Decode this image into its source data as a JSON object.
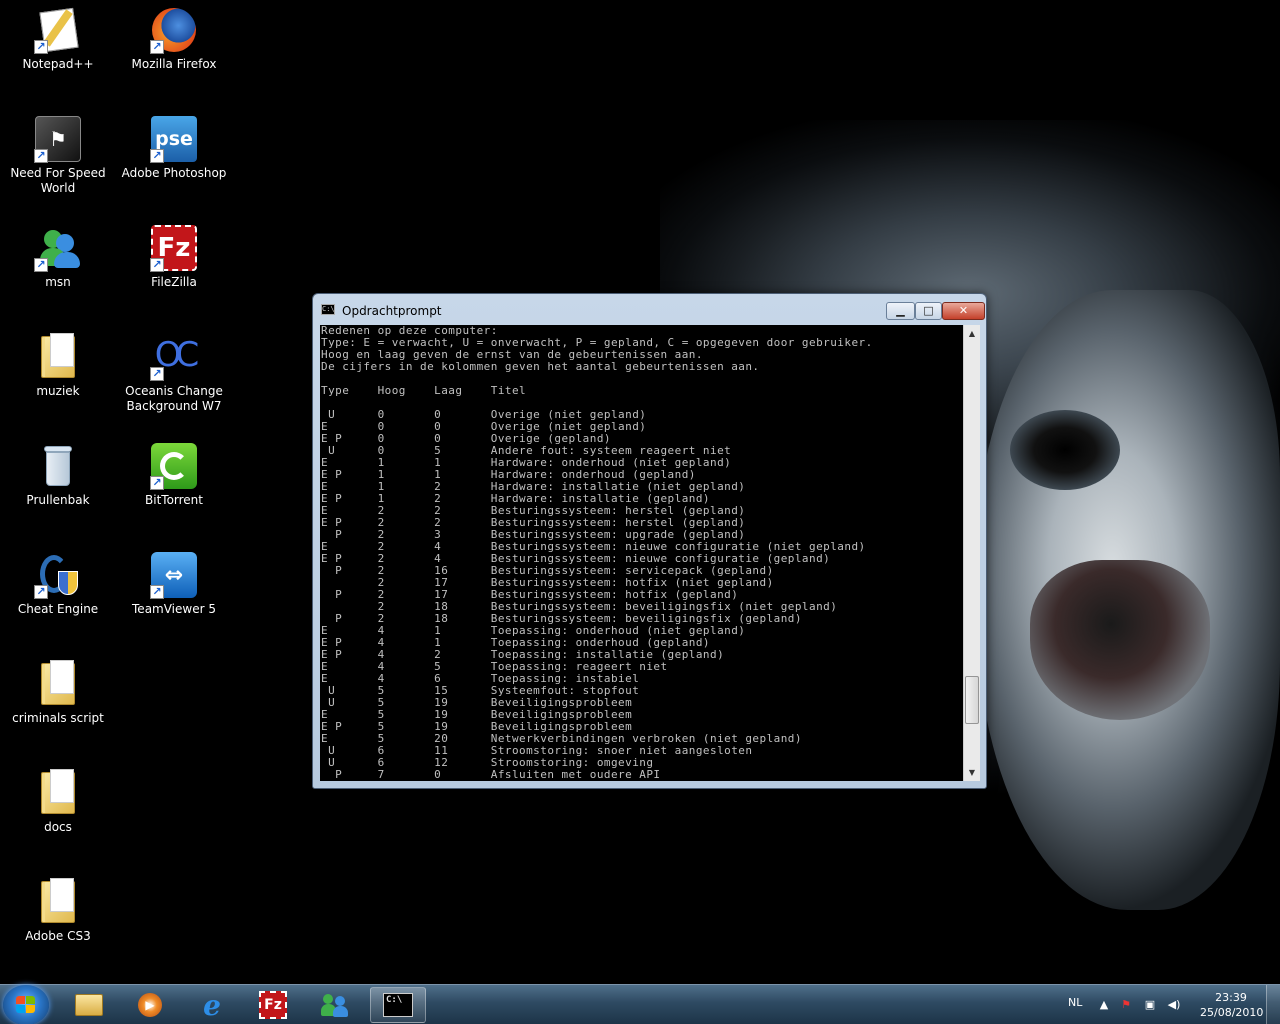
{
  "desktop": {
    "icons": [
      {
        "label": "Notepad++",
        "icon": "notepad-icon"
      },
      {
        "label": "Mozilla Firefox",
        "icon": "firefox-icon"
      },
      {
        "label": "Need For Speed World",
        "icon": "nfs-icon"
      },
      {
        "label": "Adobe Photoshop",
        "icon": "photoshop-icon"
      },
      {
        "label": "msn",
        "icon": "msn-icon"
      },
      {
        "label": "FileZilla",
        "icon": "filezilla-icon"
      },
      {
        "label": "muziek",
        "icon": "folder-icon"
      },
      {
        "label": "Oceanis Change Background W7",
        "icon": "oceanis-icon"
      },
      {
        "label": "Prullenbak",
        "icon": "recycle-bin-icon"
      },
      {
        "label": "BitTorrent",
        "icon": "bittorrent-icon"
      },
      {
        "label": "Cheat Engine",
        "icon": "cheat-engine-icon"
      },
      {
        "label": "TeamViewer 5",
        "icon": "teamviewer-icon"
      },
      {
        "label": "criminals script",
        "icon": "folder-icon"
      },
      {
        "label": "docs",
        "icon": "folder-icon"
      },
      {
        "label": "Adobe CS3",
        "icon": "folder-icon"
      }
    ],
    "glyphs": {
      "pse": "pse",
      "fz": "Fz",
      "oc": "OC",
      "cmd": "C:\\"
    }
  },
  "cmd_window": {
    "title": "Opdrachtprompt",
    "buttons": {
      "minimize": "▁",
      "maximize": "□",
      "close": "✕"
    },
    "scroll": {
      "up": "▲",
      "down": "▼"
    },
    "lines": [
      "Redenen op deze computer:",
      "Type: E = verwacht, U = onverwacht, P = gepland, C = opgegeven door gebruiker.",
      "Hoog en laag geven de ernst van de gebeurtenissen aan.",
      "De cijfers in de kolommen geven het aantal gebeurtenissen aan.",
      "",
      "Type    Hoog    Laag    Titel",
      "",
      " U      0       0       Overige (niet gepland)",
      "E       0       0       Overige (niet gepland)",
      "E P     0       0       Overige (gepland)",
      " U      0       5       Andere fout: systeem reageert niet",
      "E       1       1       Hardware: onderhoud (niet gepland)",
      "E P     1       1       Hardware: onderhoud (gepland)",
      "E       1       2       Hardware: installatie (niet gepland)",
      "E P     1       2       Hardware: installatie (gepland)",
      "E       2       2       Besturingssysteem: herstel (gepland)",
      "E P     2       2       Besturingssysteem: herstel (gepland)",
      "  P     2       3       Besturingssysteem: upgrade (gepland)",
      "E       2       4       Besturingssysteem: nieuwe configuratie (niet gepland)",
      "E P     2       4       Besturingssysteem: nieuwe configuratie (gepland)",
      "  P     2       16      Besturingssysteem: servicepack (gepland)",
      "        2       17      Besturingssysteem: hotfix (niet gepland)",
      "  P     2       17      Besturingssysteem: hotfix (gepland)",
      "        2       18      Besturingssysteem: beveiligingsfix (niet gepland)",
      "  P     2       18      Besturingssysteem: beveiligingsfix (gepland)",
      "E       4       1       Toepassing: onderhoud (niet gepland)",
      "E P     4       1       Toepassing: onderhoud (gepland)",
      "E P     4       2       Toepassing: installatie (gepland)",
      "E       4       5       Toepassing: reageert niet",
      "E       4       6       Toepassing: instabiel",
      " U      5       15      Systeemfout: stopfout",
      " U      5       19      Beveiligingsprobleem",
      "E       5       19      Beveiligingsprobleem",
      "E P     5       19      Beveiligingsprobleem",
      "E       5       20      Netwerkverbindingen verbroken (niet gepland)",
      " U      6       11      Stroomstoring: snoer niet aangesloten",
      " U      6       12      Stroomstoring: omgeving",
      "  P     7       0       Afsluiten met oudere API"
    ]
  },
  "taskbar": {
    "pinned": [
      {
        "icon": "explorer-icon"
      },
      {
        "icon": "media-player-icon"
      },
      {
        "icon": "internet-explorer-icon"
      },
      {
        "icon": "filezilla-icon"
      },
      {
        "icon": "msn-icon"
      },
      {
        "icon": "cmd-icon",
        "active": true
      }
    ],
    "tray": {
      "language": "NL",
      "time": "23:39",
      "date": "25/08/2010",
      "icons": [
        "show-hidden-icons-icon",
        "action-center-icon",
        "network-icon",
        "volume-icon"
      ],
      "glyphs": {
        "show_hidden": "▲",
        "action_center": "⚑",
        "network": "▣",
        "volume": "◀)"
      }
    },
    "colors": {
      "accent": "#2a76c8"
    }
  }
}
